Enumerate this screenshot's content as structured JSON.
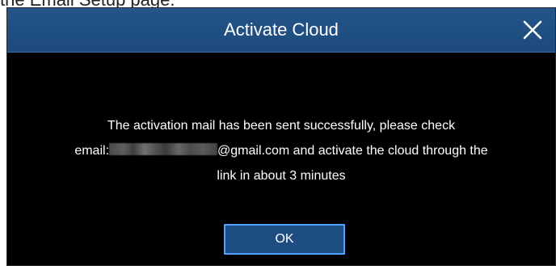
{
  "page_caption": "the Email Setup page.",
  "dialog": {
    "title": "Activate Cloud",
    "close_icon": "close-icon",
    "message": {
      "line1": "The activation mail has been sent successfully, please check",
      "line2_prefix": "email:",
      "line2_suffix": "@gmail.com and activate the cloud through the",
      "line3": "link in about 3 minutes"
    },
    "ok_label": "OK"
  },
  "colors": {
    "header_blue": "#1f4f82",
    "button_border": "#4fa3ff",
    "dialog_background": "#000000",
    "text": "#ffffff"
  }
}
